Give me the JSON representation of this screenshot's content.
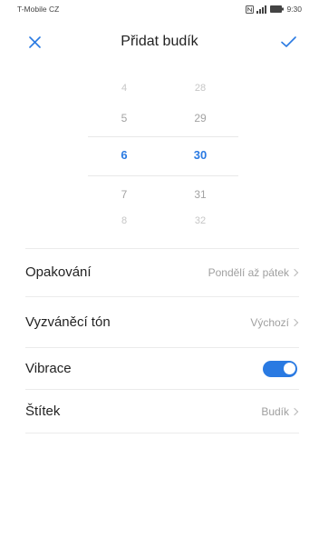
{
  "status_bar": {
    "carrier": "T-Mobile CZ",
    "time": "9:30",
    "icons": [
      "nfc-icon",
      "signal-icon",
      "battery-icon"
    ]
  },
  "header": {
    "title": "Přidat budík",
    "close_icon": "close-icon",
    "confirm_icon": "check-icon"
  },
  "time_picker": {
    "hours": [
      "4",
      "5",
      "6",
      "7",
      "8"
    ],
    "minutes": [
      "28",
      "29",
      "30",
      "31",
      "32"
    ],
    "selected_index": 2
  },
  "settings": [
    {
      "label": "Opakování",
      "value": "Pondělí až pátek",
      "icon": "chevron-right-icon"
    },
    {
      "label": "Vyzváněcí tón",
      "value": "Výchozí",
      "icon": "chevron-right-icon"
    },
    {
      "label": "Vibrace",
      "toggle_on": true
    },
    {
      "label": "Štítek",
      "value": "Budík",
      "icon": "chevron-right-icon"
    }
  ],
  "colors": {
    "accent": "#2a7ae2",
    "text": "#222222",
    "secondary": "#a0a0a0"
  }
}
